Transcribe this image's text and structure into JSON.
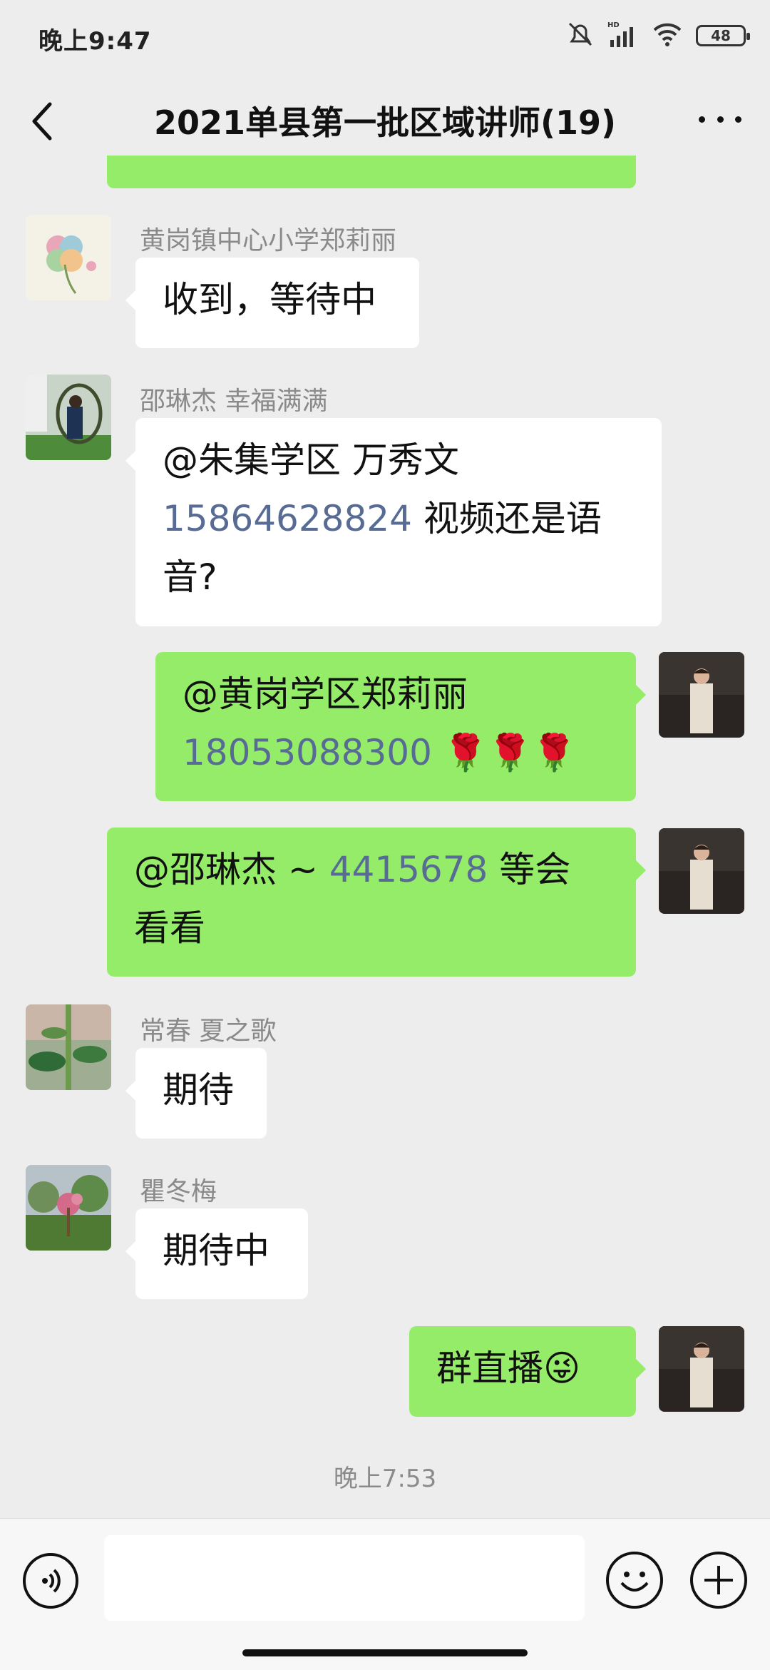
{
  "status": {
    "time": "晚上9:47",
    "battery": "48",
    "network": "HD"
  },
  "header": {
    "title": "2021单县第一批区域讲师(19)"
  },
  "messages": [
    {
      "sender": "黄岗镇中心小学郑莉丽",
      "text": "收到，等待中"
    },
    {
      "sender": "邵琳杰  幸福满满",
      "line1": "@朱集学区  万秀文",
      "line2_phone": "15864628824",
      "line2_text": " 视频还是语",
      "line3": "音?"
    },
    {
      "line1": "@黄岗学区郑莉丽",
      "phone": "18053088300",
      "emojis": " 🌹🌹🌹"
    },
    {
      "prefix": "@邵琳杰 ~ ",
      "phone": "4415678",
      "suffix": " 等会",
      "line2": "看看"
    },
    {
      "sender": "常春  夏之歌",
      "text": "期待"
    },
    {
      "sender": "瞿冬梅",
      "text": "期待中"
    },
    {
      "text": "群直播😜"
    }
  ],
  "timestamp": "晚上7:53",
  "input": {
    "placeholder": ""
  },
  "colors": {
    "background": "#EDEDED",
    "bubble_self": "#95EC69",
    "bubble_other": "#FFFFFF",
    "link": "#576B95"
  }
}
